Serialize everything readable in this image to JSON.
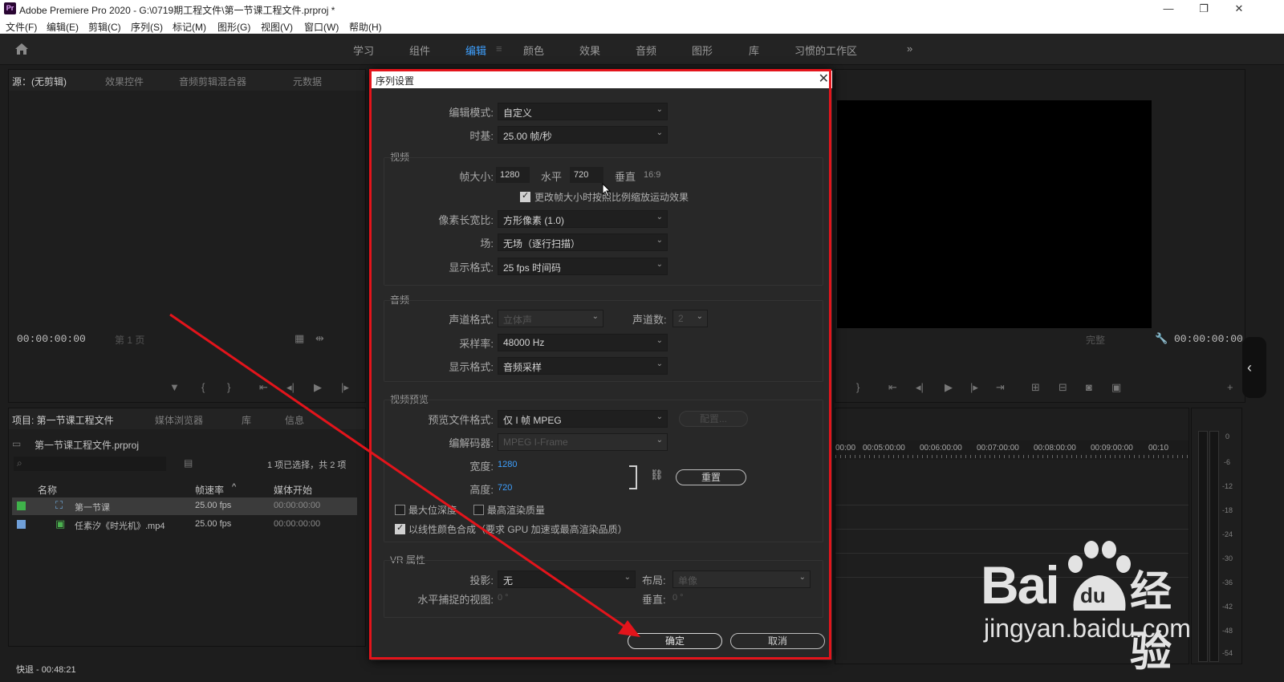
{
  "window": {
    "title": "Adobe Premiere Pro 2020 - G:\\0719期工程文件\\第一节课工程文件.prproj *",
    "app_icon": "Pr",
    "controls": {
      "minimize": "—",
      "restore": "❐",
      "close": "✕"
    }
  },
  "menu": [
    "文件(F)",
    "编辑(E)",
    "剪辑(C)",
    "序列(S)",
    "标记(M)",
    "图形(G)",
    "视图(V)",
    "窗口(W)",
    "帮助(H)"
  ],
  "workspaces": {
    "tabs": [
      "学习",
      "组件",
      "编辑",
      "颜色",
      "效果",
      "音频",
      "图形",
      "库",
      "习惯的工作区"
    ],
    "active": "编辑",
    "overflow": "»"
  },
  "source_panel": {
    "tabs": [
      "源：(无剪辑)",
      "效果控件",
      "音频剪辑混合器",
      "元数据"
    ],
    "timecode": "00:00:00:00",
    "page": "第 1 页"
  },
  "program_panel": {
    "timecode": "00:00:00:00",
    "fit": "完整"
  },
  "project_panel": {
    "tabs": [
      "项目: 第一节课工程文件",
      "媒体浏览器",
      "库",
      "信息"
    ],
    "file": "第一节课工程文件.prproj",
    "selection": "1 项已选择，共 2 项",
    "columns": [
      "名称",
      "帧速率",
      "媒体开始"
    ],
    "items": [
      {
        "name": "第一节课",
        "fps": "25.00 fps",
        "start": "00:00:00:00",
        "color": "#3fb24a"
      },
      {
        "name": "任素汐《时光机》.mp4",
        "fps": "25.00 fps",
        "start": "00:00:00:00",
        "color": "#6f9fd8"
      }
    ],
    "status": "快退 - 00:48:21"
  },
  "timeline": {
    "ruler": [
      "00:00",
      "00:05:00:00",
      "00:06:00:00",
      "00:07:00:00",
      "00:08:00:00",
      "00:09:00:00",
      "00:10"
    ]
  },
  "audio_meter": {
    "ticks": [
      "0",
      "-6",
      "-12",
      "-18",
      "-24",
      "-30",
      "-36",
      "-42",
      "-48",
      "-54"
    ]
  },
  "dialog": {
    "title": "序列设置",
    "edit_mode": {
      "label": "编辑模式:",
      "value": "自定义"
    },
    "timebase": {
      "label": "时基:",
      "value": "25.00  帧/秒"
    },
    "video": {
      "section": "视频",
      "frame_size_label": "帧大小:",
      "width": "1280",
      "h_label": "水平",
      "height": "720",
      "v_label": "垂直",
      "ratio": "16:9",
      "scale_checkbox": "更改帧大小时按照比例缩放运动效果",
      "pixel_aspect": {
        "label": "像素长宽比:",
        "value": "方形像素 (1.0)"
      },
      "fields": {
        "label": "场:",
        "value": "无场（逐行扫描）"
      },
      "display_format": {
        "label": "显示格式:",
        "value": "25 fps 时间码"
      }
    },
    "audio": {
      "section": "音频",
      "channel_format": {
        "label": "声道格式:",
        "value": "立体声"
      },
      "channels": {
        "label": "声道数:",
        "value": "2"
      },
      "sample_rate": {
        "label": "采样率:",
        "value": "48000 Hz"
      },
      "display_format": {
        "label": "显示格式:",
        "value": "音频采样"
      }
    },
    "preview": {
      "section": "视频预览",
      "file_format": {
        "label": "预览文件格式:",
        "value": "仅 I 帧 MPEG"
      },
      "config_button": "配置...",
      "codec": {
        "label": "编解码器:",
        "value": "MPEG I-Frame"
      },
      "width_label": "宽度:",
      "width": "1280",
      "height_label": "高度:",
      "height": "720",
      "reset_button": "重置",
      "max_bit_depth": "最大位深度",
      "max_render_quality": "最高渲染质量",
      "linear_color": "以线性颜色合成（要求 GPU 加速或最高渲染品质）"
    },
    "vr": {
      "section": "VR 属性",
      "projection": {
        "label": "投影:",
        "value": "无"
      },
      "layout": {
        "label": "布局:",
        "value": "单像"
      },
      "h_view": {
        "label": "水平捕捉的视图:",
        "value": "0 °"
      },
      "v_view": {
        "label": "垂直:",
        "value": "0 °"
      }
    },
    "ok_button": "确定",
    "cancel_button": "取消"
  },
  "watermark": {
    "brand": "Bai",
    "brand2": "du",
    "cn": "经验",
    "url": "jingyan.baidu.com"
  },
  "colors": {
    "accent": "#3ea0ff",
    "highlight_red": "#e3141b"
  }
}
